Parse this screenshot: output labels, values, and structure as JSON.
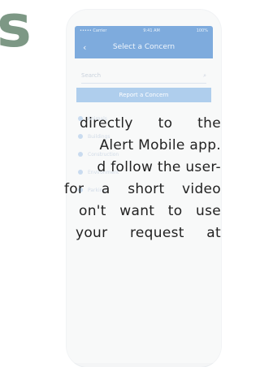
{
  "heading": {
    "text": "s"
  },
  "colors": {
    "heading": "#2e5a3a",
    "phone_blue": "#2f78c8"
  },
  "phone": {
    "status_left": "••••• Carrier",
    "status_center": "9:41 AM",
    "status_right": "100%",
    "nav_title": "Select a Concern",
    "back_icon": "chevron-left-icon",
    "search_placeholder": "Search",
    "report_button": "Report a Concern",
    "items": [
      "Animals",
      "Buildings",
      "Construction",
      "Environment",
      "Parking"
    ]
  },
  "paragraph": {
    "lines": [
      "directly to the",
      "Alert Mobile app.",
      "d follow the user-",
      "for a short video",
      "on't want to use",
      "your request at"
    ]
  }
}
